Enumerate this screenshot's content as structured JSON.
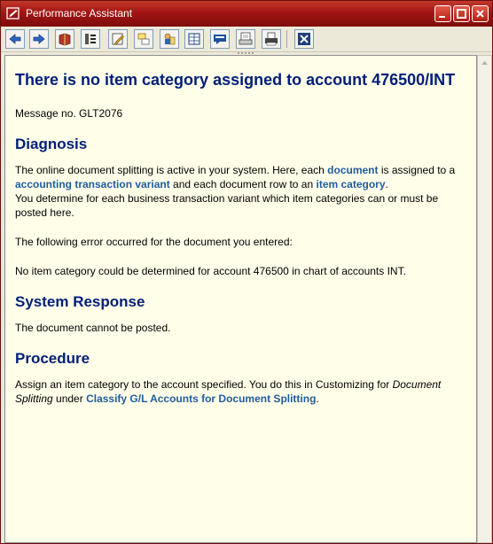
{
  "window": {
    "title": "Performance Assistant"
  },
  "toolbar": {
    "buttons": [
      {
        "name": "back-icon"
      },
      {
        "name": "forward-icon"
      },
      {
        "name": "book-icon"
      },
      {
        "name": "technical-info-icon"
      },
      {
        "name": "edit-icon"
      },
      {
        "name": "split-view-icon"
      },
      {
        "name": "users-icon"
      },
      {
        "name": "table-icon"
      },
      {
        "name": "chat-icon"
      },
      {
        "name": "print-preview-icon"
      },
      {
        "name": "print-icon"
      },
      {
        "name": "close-icon"
      }
    ]
  },
  "doc": {
    "heading": "There is no item category assigned to account 476500/INT",
    "message_no": "Message no. GLT2076",
    "diagnosis": {
      "heading": "Diagnosis",
      "p1_a": "The online document splitting is active in your system. Here, each ",
      "p1_link1": "document",
      "p1_b": " is assigned to a ",
      "p1_link2": "accounting transaction variant",
      "p1_c": " and each document row to an ",
      "p1_link3": "item category",
      "p1_d": ".",
      "p2": "You determine for each business transaction variant which item categories can or must be posted here.",
      "p3": "The following error occurred for the document you entered:",
      "p4": "No item category could be determined for account 476500 in chart of accounts INT."
    },
    "system_response": {
      "heading": "System Response",
      "p1": "The document cannot be posted."
    },
    "procedure": {
      "heading": "Procedure",
      "p1_a": "Assign an item category to the account specified. You do this in Customizing for ",
      "p1_em": "Document Splitting",
      "p1_b": " under ",
      "p1_link": "Classify G/L Accounts for Document Splitting",
      "p1_c": "."
    }
  },
  "colors": {
    "titlebar": "#a31414",
    "heading": "#001e78",
    "link": "#1f5c9e",
    "content_bg": "#ffffe9"
  }
}
